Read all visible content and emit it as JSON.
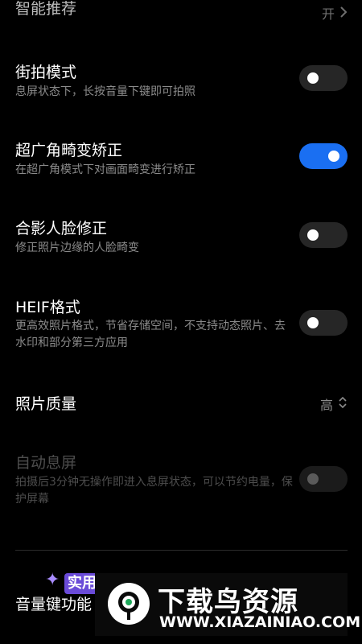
{
  "top_item": {
    "label": "智能推荐",
    "value": "开"
  },
  "settings": [
    {
      "title": "街拍模式",
      "desc": "息屏状态下，长按音量下键即可拍照",
      "state": "off"
    },
    {
      "title": "超广角畸变矫正",
      "desc": "在超广角模式下对画面畸变进行矫正",
      "state": "on"
    },
    {
      "title": "合影人脸修正",
      "desc": "修正照片边缘的人脸畸变",
      "state": "off"
    },
    {
      "title": "HEIF格式",
      "desc": "更高效照片格式，节省存储空间，不支持动态照片、去水印和部分第三方应用",
      "state": "off"
    },
    {
      "title": "照片质量",
      "value": "高"
    },
    {
      "title": "自动息屏",
      "desc": "拍摄后3分钟无操作即进入息屏状态，可以节约电量，保护屏幕",
      "state": "disabled"
    }
  ],
  "bottom_item": {
    "label": "音量键功能"
  },
  "watermark": {
    "badge": "实用",
    "title": "下载鸟资源",
    "url": "WWW.XIAZAINIAO.COM"
  },
  "colors": {
    "toggle_on": "#1a6ff2",
    "toggle_off": "#262626",
    "background": "#000000"
  }
}
